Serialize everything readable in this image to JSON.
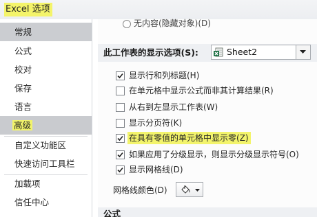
{
  "window": {
    "title": "Excel 选项"
  },
  "sidebar": {
    "items": [
      {
        "label": "常规"
      },
      {
        "label": "公式"
      },
      {
        "label": "校对"
      },
      {
        "label": "保存"
      },
      {
        "label": "语言"
      },
      {
        "label": "高级"
      },
      {
        "label": "自定义功能区"
      },
      {
        "label": "快速访问工具栏"
      },
      {
        "label": "加载项"
      },
      {
        "label": "信任中心"
      }
    ],
    "selected": "高级"
  },
  "main": {
    "partial_option": "无内容(隐藏对象)(D)",
    "worksheet_section": {
      "title": "此工作表的显示选项(S):",
      "sheet_select": {
        "value": "Sheet2",
        "icon": "excel-sheet-icon"
      }
    },
    "options": [
      {
        "label": "显示行和列标题(H)",
        "checked": true
      },
      {
        "label": "在单元格中显示公式而非其计算结果(R)",
        "checked": false
      },
      {
        "label": "从右到左显示工作表(W)",
        "checked": false
      },
      {
        "label": "显示分页符(K)",
        "checked": false
      },
      {
        "label": "在具有零值的单元格中显示零(Z)",
        "checked": true,
        "highlighted": true
      },
      {
        "label": "如果应用了分级显示，则显示分级显示符号(O)",
        "checked": true
      },
      {
        "label": "显示网格线(D)",
        "checked": true
      }
    ],
    "gridline_color": {
      "label": "网格线颜色(D)",
      "icon": "paint-bucket-icon"
    },
    "next_section": {
      "title": "公式"
    }
  },
  "colors": {
    "highlight": "#f3f46c",
    "selected_bg": "#c9cbcf",
    "excel_green": "#1e7145"
  }
}
